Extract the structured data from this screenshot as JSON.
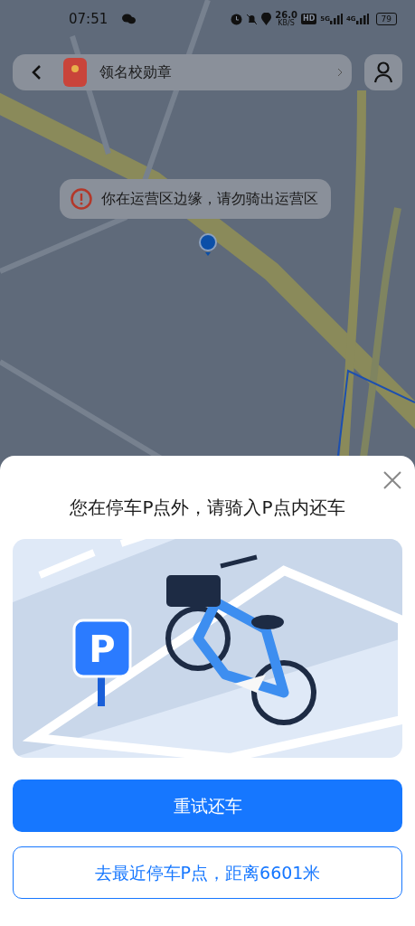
{
  "status_bar": {
    "time": "07:51",
    "speed": "26.0",
    "speed_unit": "KB/S",
    "hd": "HD",
    "network_1": "5G",
    "network_2": "4G",
    "battery": "79"
  },
  "top_bar": {
    "banner": "领名校勋章"
  },
  "toast": {
    "message": "你在运营区边缘，请勿骑出运营区"
  },
  "sheet": {
    "title": "您在停车P点外，请骑入P点内还车",
    "sign_letter": "P",
    "buttons": [
      {
        "label": "重试还车",
        "kind": "primary"
      },
      {
        "label": "去最近停车P点，距离6601米",
        "kind": "outline"
      }
    ]
  }
}
